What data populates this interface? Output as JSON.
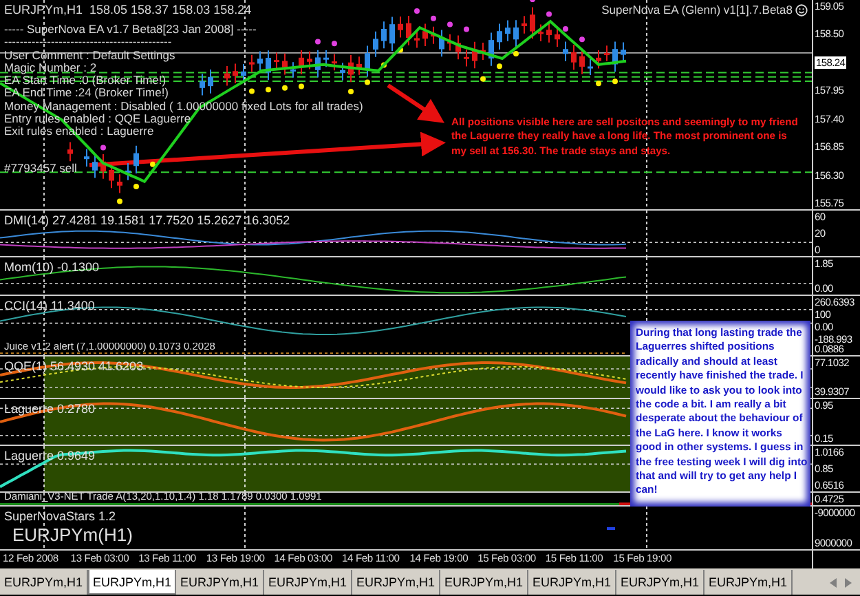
{
  "chart_title": {
    "symbol": "EURJPYm,H1",
    "ohlc": "158.05 158.37 158.03 158.24"
  },
  "ea_info": [
    "----- SuperNova EA v1.7 Beta8[23 Jan 2008] -----",
    "-------------------------------------------",
    "User Comment : Default Settings",
    "Magic Number : 2",
    "EA Start Time :0 (Broker Time!)",
    "EA End Time :24 (Broker Time!)",
    "Money Management : Disabled ( 1.00000000 fixed Lots for all trades)",
    "Entry rules enabled : QQE Laguerre",
    "Exit rules enabled :  Laguerre"
  ],
  "order_label": "#7793457 sell",
  "ea_badge": "SuperNova EA (Glenn) v1[1].7.Beta8",
  "annotation": "All positions visible here are sell positons and seemingly to my friend the Laguerre they really have a long life. The most prominent one is my sell at 156.30. The trade stays and stays.",
  "panes": [
    {
      "kind": "main",
      "axis": [
        {
          "value": "159.05",
          "highlighted": false
        },
        {
          "value": "158.50",
          "highlighted": false
        },
        {
          "value": "158.24",
          "highlighted": true
        },
        {
          "value": "157.95",
          "highlighted": false
        },
        {
          "value": "157.40",
          "highlighted": false
        },
        {
          "value": "156.85",
          "highlighted": false
        },
        {
          "value": "156.30",
          "highlighted": false
        },
        {
          "value": "155.75",
          "highlighted": false
        }
      ]
    },
    {
      "kind": "dmi",
      "label": "DMI(14) 27.4281 19.1581 17.7520 15.2627 16.3052",
      "axis": [
        "60",
        "20",
        "0"
      ]
    },
    {
      "kind": "mom",
      "label": "Mom(10) -0.1300",
      "axis": [
        "1.85",
        "0.00"
      ]
    },
    {
      "kind": "cci",
      "label": "CCI(14) 11.3400",
      "axis": [
        "260.6393",
        "100",
        "0.00",
        "-188.993"
      ]
    },
    {
      "kind": "juice",
      "label": "Juice v1.2 alert (7,1.00000000) 0.1073 0.2028",
      "axis": [
        "0.0886"
      ]
    },
    {
      "kind": "qqe",
      "label": "QQE(1) 56.4930 41.6203",
      "axis": [
        "77.1032",
        "39.9307"
      ]
    },
    {
      "kind": "laguerre",
      "label": "Laguerre 0.2780",
      "axis": [
        "0.95",
        "0.15"
      ]
    },
    {
      "kind": "laguerre2",
      "label": "Laguerre 0.9649",
      "axis": [
        "1.0166",
        "0.85",
        "0.6516"
      ]
    },
    {
      "kind": "damiani",
      "label": "Damiani_V3-NET Trade A(13,20,1.10,1.4) 1.18 1.1789 0.0300 1.0991",
      "axis": [
        "0.4725"
      ]
    },
    {
      "kind": "stars",
      "label": "SuperNovaStars 1.2",
      "sublabel": "EURJPYm(H1)",
      "axis": [
        "-9000000",
        "9000000"
      ]
    }
  ],
  "note": "During that long lasting trade the Laguerres shifted positions radically and should at least recently have finished the trade. I would like to ask you to look into the code a bit. I am really a bit desperate about the behaviour of the LaG here. I know it works good in other systems. I guess in the free testing week I will dig into that and will try to get any help I can!",
  "time_axis": [
    "12 Feb 2008",
    "13 Feb 03:00",
    "13 Feb 11:00",
    "13 Feb 19:00",
    "14 Feb 03:00",
    "14 Feb 11:00",
    "14 Feb 19:00",
    "15 Feb 03:00",
    "15 Feb 11:00",
    "15 Feb 19:00"
  ],
  "tabs": [
    {
      "label": "EURJPYm,H1",
      "selected": false
    },
    {
      "label": "EURJPYm,H1",
      "selected": true
    },
    {
      "label": "EURJPYm,H1",
      "selected": false
    },
    {
      "label": "EURJPYm,H1",
      "selected": false
    },
    {
      "label": "EURJPYm,H1",
      "selected": false
    },
    {
      "label": "EURJPYm,H1",
      "selected": false
    },
    {
      "label": "EURJPYm,H1",
      "selected": false
    },
    {
      "label": "EURJPYm,H1",
      "selected": false
    },
    {
      "label": "EURJPYm,H1",
      "selected": false
    }
  ]
}
